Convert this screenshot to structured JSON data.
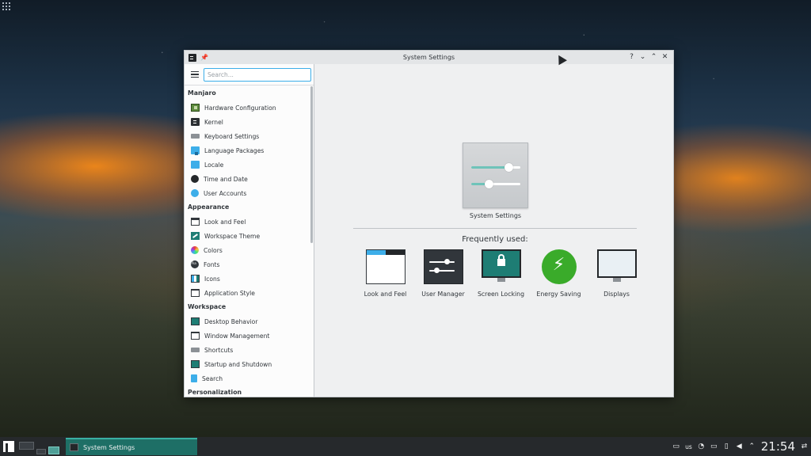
{
  "window": {
    "title": "System Settings",
    "buttons": {
      "help": "?",
      "minimize": "⌄",
      "maximize": "⌃",
      "close": "✕"
    }
  },
  "sidebar": {
    "search_placeholder": "Search...",
    "categories": [
      {
        "name": "Manjaro",
        "items": [
          {
            "label": "Hardware Configuration",
            "icon": "hardware-icon"
          },
          {
            "label": "Kernel",
            "icon": "kernel-icon"
          },
          {
            "label": "Keyboard Settings",
            "icon": "keyboard-icon"
          },
          {
            "label": "Language Packages",
            "icon": "language-icon"
          },
          {
            "label": "Locale",
            "icon": "locale-icon"
          },
          {
            "label": "Time and Date",
            "icon": "clock-icon"
          },
          {
            "label": "User Accounts",
            "icon": "user-icon"
          }
        ]
      },
      {
        "name": "Appearance",
        "items": [
          {
            "label": "Look and Feel",
            "icon": "look-feel-icon"
          },
          {
            "label": "Workspace Theme",
            "icon": "workspace-theme-icon"
          },
          {
            "label": "Colors",
            "icon": "colors-icon"
          },
          {
            "label": "Fonts",
            "icon": "fonts-icon"
          },
          {
            "label": "Icons",
            "icon": "icons-icon"
          },
          {
            "label": "Application Style",
            "icon": "application-style-icon"
          }
        ]
      },
      {
        "name": "Workspace",
        "items": [
          {
            "label": "Desktop Behavior",
            "icon": "desktop-behavior-icon"
          },
          {
            "label": "Window Management",
            "icon": "window-management-icon"
          },
          {
            "label": "Shortcuts",
            "icon": "shortcuts-icon"
          },
          {
            "label": "Startup and Shutdown",
            "icon": "startup-icon"
          },
          {
            "label": "Search",
            "icon": "search-icon"
          }
        ]
      },
      {
        "name": "Personalization",
        "items": []
      }
    ]
  },
  "main": {
    "hero_label": "System Settings",
    "frequently_used_title": "Frequently used:",
    "frequent": [
      {
        "label": "Look and Feel",
        "icon": "look-feel-icon"
      },
      {
        "label": "User Manager",
        "icon": "user-manager-icon"
      },
      {
        "label": "Screen Locking",
        "icon": "screen-lock-icon"
      },
      {
        "label": "Energy Saving",
        "icon": "energy-icon"
      },
      {
        "label": "Displays",
        "icon": "display-icon"
      }
    ]
  },
  "taskbar": {
    "task_label": "System Settings",
    "keyboard_layout": "us",
    "clock": "21:54"
  },
  "colors": {
    "accent": "#3daee9",
    "teal": "#1e7d74",
    "taskbar": "#26292c"
  }
}
